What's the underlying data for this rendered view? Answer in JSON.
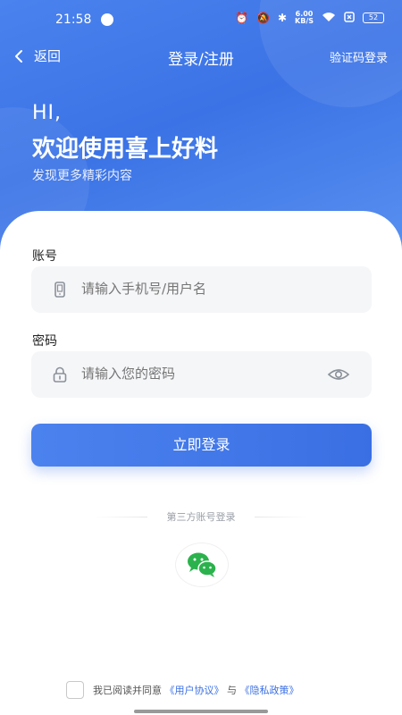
{
  "status_bar": {
    "time": "21:58",
    "net_speed_value": "6.00",
    "net_speed_unit": "KB/S",
    "battery": "52"
  },
  "navbar": {
    "back_label": "返回",
    "title": "登录/注册",
    "right_action": "验证码登录"
  },
  "greeting": {
    "hi": "HI,",
    "title": "欢迎使用喜上好料",
    "subtitle": "发现更多精彩内容"
  },
  "form": {
    "account_label": "账号",
    "account_placeholder": "请输入手机号/用户名",
    "password_label": "密码",
    "password_placeholder": "请输入您的密码",
    "login_button": "立即登录"
  },
  "third_party": {
    "title": "第三方账号登录"
  },
  "agreement": {
    "prefix": "我已阅读并同意",
    "user_agreement": "《用户协议》",
    "conjunction": "与",
    "privacy_policy": "《隐私政策》"
  },
  "colors": {
    "brand_blue": "#3a6fe3",
    "wechat_green": "#2bb24c"
  }
}
